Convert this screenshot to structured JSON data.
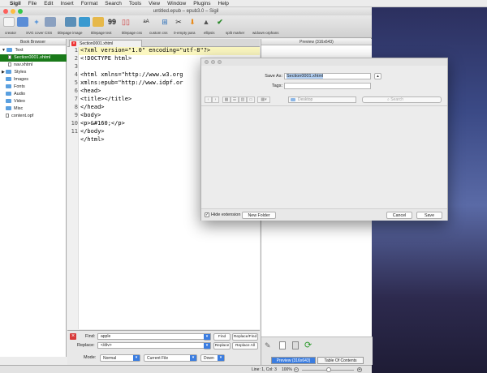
{
  "menubar": {
    "items": [
      "Sigil",
      "File",
      "Edit",
      "Insert",
      "Format",
      "Search",
      "Tools",
      "View",
      "Window",
      "Plugins",
      "Help"
    ]
  },
  "window": {
    "title": "untitled.epub – epub3.0 – Sigil"
  },
  "toolbar": {
    "labels": [
      "creator",
      "SVG cover CSS",
      "titlepage image",
      "titlepage text",
      "titlepage css",
      "custom css",
      "0-empty para",
      "ellipsis",
      "split marker",
      "widows-orphans"
    ],
    "font_label": "aA",
    "quote_label": "99"
  },
  "book_browser": {
    "title": "Book Browser",
    "items": [
      {
        "label": "Text",
        "kind": "folder",
        "depth": 0,
        "expanded": true
      },
      {
        "label": "Section0001.xhtml",
        "kind": "file",
        "depth": 1,
        "selected": true
      },
      {
        "label": "nav.xhtml",
        "kind": "file",
        "depth": 1
      },
      {
        "label": "Styles",
        "kind": "folder",
        "depth": 0
      },
      {
        "label": "Images",
        "kind": "folder",
        "depth": 0
      },
      {
        "label": "Fonts",
        "kind": "folder",
        "depth": 0
      },
      {
        "label": "Audio",
        "kind": "folder",
        "depth": 0
      },
      {
        "label": "Video",
        "kind": "folder",
        "depth": 0
      },
      {
        "label": "Misc",
        "kind": "folder",
        "depth": 0
      },
      {
        "label": "content.opf",
        "kind": "file",
        "depth": 0
      }
    ]
  },
  "editor": {
    "tab_label": "Section0001.xhtml",
    "lines": [
      "<?xml version=\"1.0\" encoding=\"utf-8\"?>",
      "<!DOCTYPE html>",
      "",
      "<html xmlns=\"http://www.w3.org",
      "xmlns:epub=\"http://www.idpf.or",
      "<head>",
      "<title></title>",
      "</head>",
      "<body>",
      "<p>&#160;</p>",
      "</body>",
      "</html>"
    ],
    "line_numbers": [
      "1",
      "2",
      "3",
      "4",
      "5",
      "6",
      "7",
      "8",
      "9",
      "10",
      "11"
    ]
  },
  "find": {
    "find_label": "Find:",
    "find_value": "apple",
    "replace_label": "Replace:",
    "replace_value": "</div>",
    "mode_label": "Mode:",
    "mode_value": "Normal",
    "scope_value": "Current File",
    "direction_value": "Down",
    "find_btn": "Find",
    "replace_find_btn": "Replace/Find",
    "replace_btn": "Replace",
    "replace_all_btn": "Replace All"
  },
  "preview": {
    "title": "Preview (316x643)",
    "tab_preview": "Preview (316x643)",
    "tab_toc": "Table Of Contents"
  },
  "status": {
    "position": "Line: 1, Col: 3",
    "zoom": "100%"
  },
  "dialog": {
    "save_as_label": "Save As:",
    "save_as_value": "Section0001.xhtml",
    "tags_label": "Tags:",
    "tags_value": "",
    "location": "Desktop",
    "search_placeholder": "Search",
    "hide_extension_label": "Hide extension",
    "hide_extension_checked": true,
    "new_folder_btn": "New Folder",
    "cancel_btn": "Cancel",
    "save_btn": "Save"
  },
  "colors": {
    "accent": "#3b7de0",
    "selection": "#1a7a1a",
    "current_line": "#fbf7c0"
  }
}
